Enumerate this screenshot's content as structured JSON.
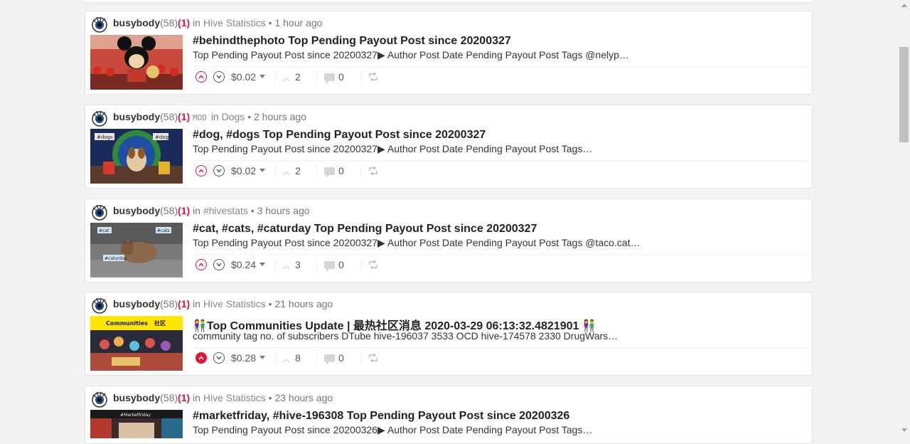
{
  "posts": [
    {
      "author": "busybody",
      "reputation": "(58)",
      "flag": "(1)",
      "mod": "",
      "community_prefix": "in",
      "community": "Hive Statistics",
      "time": "• 1 hour ago",
      "title": "#behindthephoto Top Pending Payout Post since 20200327",
      "summary": "Top Pending Payout Post since 20200327▶ Author Post Date Pending Payout Post Tags @nelyp…",
      "payout": "$0.02",
      "votes": "2",
      "comments": "0",
      "upvoted": false
    },
    {
      "author": "busybody",
      "reputation": "(58)",
      "flag": "(1)",
      "mod": "MOD",
      "community_prefix": "in",
      "community": "Dogs",
      "time": "• 2 hours ago",
      "title": "#dog, #dogs Top Pending Payout Post since 20200327",
      "summary": "Top Pending Payout Post since 20200327▶ Author Post Date Pending Payout Post Tags…",
      "payout": "$0.02",
      "votes": "2",
      "comments": "0",
      "upvoted": false
    },
    {
      "author": "busybody",
      "reputation": "(58)",
      "flag": "(1)",
      "mod": "",
      "community_prefix": "in",
      "community": "#hivestats",
      "time": "• 3 hours ago",
      "title": "#cat, #cats, #caturday Top Pending Payout Post since 20200327",
      "summary": "Top Pending Payout Post since 20200327▶ Author Post Date Pending Payout Post Tags @taco.cat…",
      "payout": "$0.24",
      "votes": "3",
      "comments": "0",
      "upvoted": false
    },
    {
      "author": "busybody",
      "reputation": "(58)",
      "flag": "(1)",
      "mod": "",
      "community_prefix": "in",
      "community": "Hive Statistics",
      "time": "• 21 hours ago",
      "title": "👫Top Communities Update | 最热社区消息 2020-03-29 06:13:32.4821901 👫",
      "summary": "community tag no. of subscribers DTube hive-196037 3533 OCD hive-174578 2330 DrugWars…",
      "payout": "$0.28",
      "votes": "8",
      "comments": "0",
      "upvoted": true
    },
    {
      "author": "busybody",
      "reputation": "(58)",
      "flag": "(1)",
      "mod": "",
      "community_prefix": "in",
      "community": "Hive Statistics",
      "time": "• 23 hours ago",
      "title": "#marketfriday, #hive-196308 Top Pending Payout Post since 20200326",
      "summary": "Top Pending Payout Post since 20200326▶ Author Post Date Pending Payout Post Tags…",
      "payout": "",
      "votes": "",
      "comments": "",
      "upvoted": false
    }
  ],
  "thumbnails": [
    {
      "label": ""
    },
    {
      "label1": "#dogs",
      "label2": "#dog"
    },
    {
      "label1": "#cat",
      "label2": "#cats",
      "label3": "#caturday"
    },
    {
      "label1": "Communities",
      "label2": "社区"
    },
    {
      "label1": "#Marketfriday"
    }
  ],
  "icons": {
    "avatar": "eye-avatar-icon",
    "upvote": "chevron-up-circle-icon",
    "downvote": "chevron-down-circle-icon",
    "comment": "comment-bubble-icon",
    "reblog": "reblog-icon"
  },
  "colors": {
    "accent": "#e31337",
    "background": "#f2f2f2"
  }
}
